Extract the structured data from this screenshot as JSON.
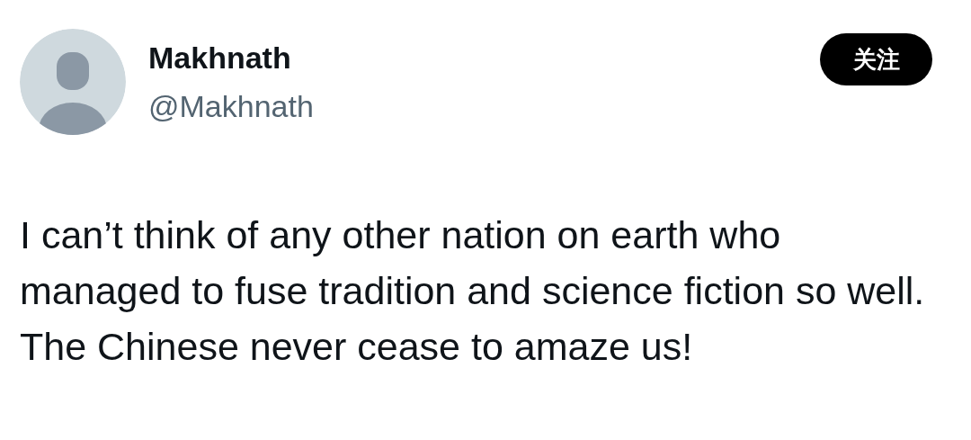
{
  "author": {
    "name": "Makhnath",
    "handle": "@Makhnath"
  },
  "follow_button": {
    "label": "关注"
  },
  "post": {
    "text": "I can’t think of any other nation on earth who managed to fuse tradition and science fiction so well.\nThe Chinese never cease to amaze us!"
  }
}
